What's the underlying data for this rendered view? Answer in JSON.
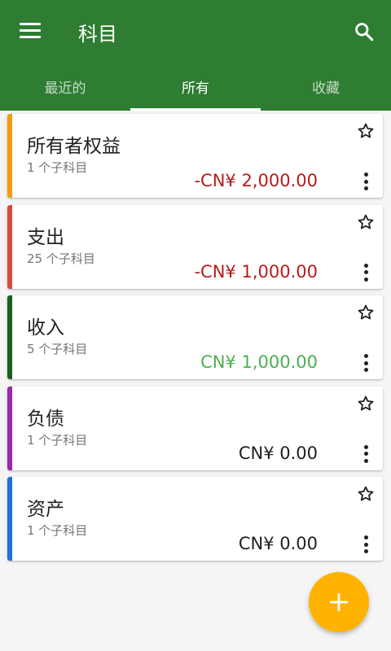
{
  "app_bar": {
    "title": "科目",
    "color": "#2e7d32"
  },
  "tabs": [
    {
      "label": "最近的",
      "active": false
    },
    {
      "label": "所有",
      "active": true
    },
    {
      "label": "收藏",
      "active": false
    }
  ],
  "accounts": [
    {
      "name": "所有者权益",
      "subaccounts": "1 个子科目",
      "balance": "-CN¥ 2,000.00",
      "balance_color": "#b71c1c",
      "stripe_color": "#f39c12"
    },
    {
      "name": "支出",
      "subaccounts": "25 个子科目",
      "balance": "-CN¥ 1,000.00",
      "balance_color": "#b71c1c",
      "stripe_color": "#d84b3b"
    },
    {
      "name": "收入",
      "subaccounts": "5 个子科目",
      "balance": "CN¥ 1,000.00",
      "balance_color": "#4caf50",
      "stripe_color": "#1b5e20"
    },
    {
      "name": "负债",
      "subaccounts": "1 个子科目",
      "balance": "CN¥ 0.00",
      "balance_color": "#212121",
      "stripe_color": "#9c27b0"
    },
    {
      "name": "资产",
      "subaccounts": "1 个子科目",
      "balance": "CN¥ 0.00",
      "balance_color": "#212121",
      "stripe_color": "#1e6fd9"
    }
  ],
  "icons": {
    "menu": "menu-icon",
    "search": "search-icon",
    "star": "star-outline-icon",
    "more": "more-vert-icon",
    "add": "plus-icon"
  },
  "fab_color": "#ffb300"
}
